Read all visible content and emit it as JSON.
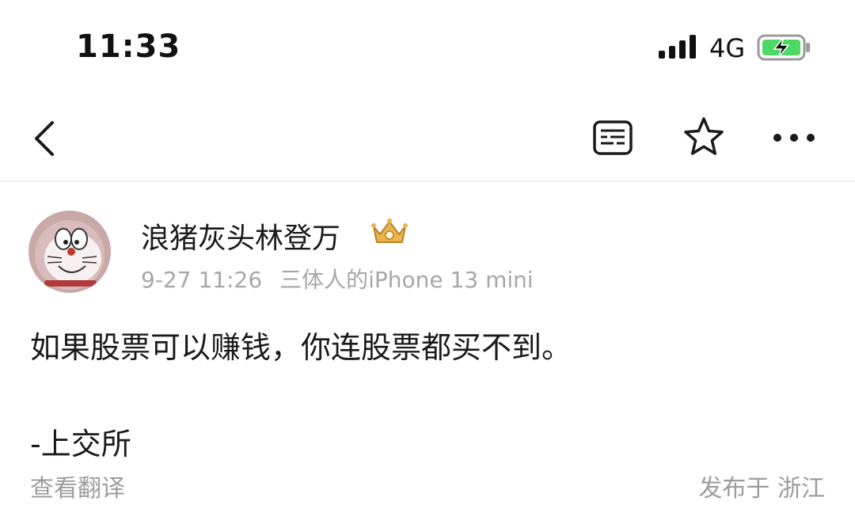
{
  "status_bar": {
    "time": "11:33",
    "network": "4G",
    "battery_color": "#4cd964"
  },
  "nav_bar": {
    "back_icon": "chevron-left-icon",
    "reader_icon": "reader-mode-icon",
    "star_icon": "star-outline-icon",
    "more_icon": "ellipsis-icon"
  },
  "post": {
    "author": "浪猪灰头林登万",
    "badge_icon": "crown-icon",
    "date": "9-27 11:26",
    "device": "三体人的iPhone 13 mini",
    "body_line_1": "如果股票可以赚钱，你连股票都买不到。",
    "body_line_2": "-上交所",
    "translate_label": "查看翻译",
    "location": "发布于 浙江"
  }
}
